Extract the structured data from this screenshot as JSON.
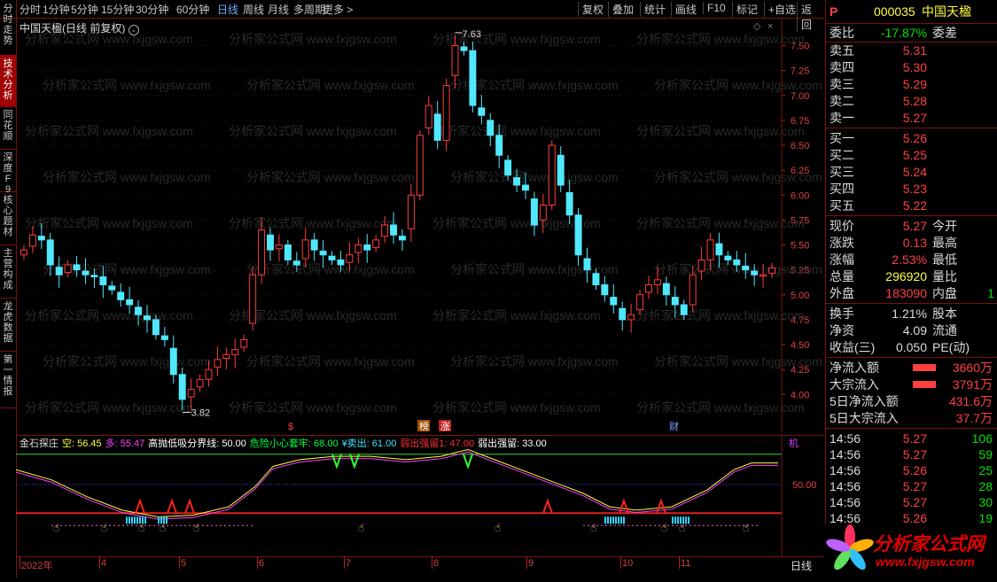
{
  "toolbar": {
    "periods": [
      "分时",
      "1分钟",
      "5分钟",
      "15分钟",
      "30分钟",
      "60分钟",
      "日线",
      "周线",
      "月线",
      "多周期",
      "更多 >"
    ],
    "active": "日线",
    "actions": [
      "复权",
      "叠加",
      "统计",
      "画线",
      "F10",
      "标记",
      "+自选",
      "返回"
    ]
  },
  "left_tabs": [
    "分时走势",
    "技术分析",
    "同花顺",
    "深度F9",
    "核心题材",
    "主营构成",
    "龙虎数据",
    "第一情报"
  ],
  "chart": {
    "title": "中国天楹(日线 前复权)",
    "high_label": "7.63",
    "low_label": "3.82",
    "y_ticks": [
      "7.50",
      "7.25",
      "7.00",
      "6.75",
      "6.50",
      "6.25",
      "6.00",
      "5.75",
      "5.50",
      "5.25",
      "5.00",
      "4.75",
      "4.50",
      "4.25",
      "4.00"
    ],
    "markers": [
      "$",
      "榜",
      "涨",
      "财"
    ],
    "watermark": "分析家公式网 www.fxjgsw.com"
  },
  "indicator": {
    "name": "金石探庄",
    "items": [
      {
        "text": "空: 56.45",
        "color": "#ffff40"
      },
      {
        "text": "多: 55.47",
        "color": "#ff40ff"
      },
      {
        "text": "高抛低吸分界线: 50.00",
        "color": "#ffffff"
      },
      {
        "text": "危险小心套牢: 68.00",
        "color": "#00ff40"
      },
      {
        "text": "¥卖出: 61.00",
        "color": "#40e0ff"
      },
      {
        "text": "弱出强留1: 47.00",
        "color": "#ff3030"
      },
      {
        "text": "弱出强留: 33.00",
        "color": "#ffffff"
      }
    ],
    "corner_label": "机",
    "y_tick": "50.00"
  },
  "time_axis": {
    "labels": [
      "2022年",
      "4",
      "5",
      "6",
      "7",
      "8",
      "9",
      "10",
      "11"
    ],
    "period": "日线"
  },
  "quote": {
    "code": "000035",
    "name": "中国天楹",
    "badge": "P",
    "weibi_label": "委比",
    "weibi": "-17.87%",
    "weicha_label": "委差",
    "sells": [
      {
        "label": "卖五",
        "price": "5.31"
      },
      {
        "label": "卖四",
        "price": "5.30"
      },
      {
        "label": "卖三",
        "price": "5.29"
      },
      {
        "label": "卖二",
        "price": "5.28"
      },
      {
        "label": "卖一",
        "price": "5.27"
      }
    ],
    "buys": [
      {
        "label": "买一",
        "price": "5.26"
      },
      {
        "label": "买二",
        "price": "5.25"
      },
      {
        "label": "买三",
        "price": "5.24"
      },
      {
        "label": "买四",
        "price": "5.23"
      },
      {
        "label": "买五",
        "price": "5.22"
      }
    ],
    "stats": [
      {
        "label": "现价",
        "value": "5.27",
        "color": "#ff4040",
        "label2": "今开"
      },
      {
        "label": "涨跌",
        "value": "0.13",
        "color": "#ff4040",
        "label2": "最高"
      },
      {
        "label": "涨幅",
        "value": "2.53%",
        "color": "#ff4040",
        "label2": "最低"
      },
      {
        "label": "总量",
        "value": "296920",
        "color": "#ffff40",
        "label2": "量比"
      },
      {
        "label": "外盘",
        "value": "183090",
        "color": "#ff4040",
        "label2": "内盘",
        "extra": "1"
      }
    ],
    "stats2": [
      {
        "label": "换手",
        "value": "1.21%",
        "label2": "股本"
      },
      {
        "label": "净资",
        "value": "4.09",
        "label2": "流通"
      },
      {
        "label": "收益(三)",
        "value": "0.050",
        "label2": "PE(动)"
      }
    ],
    "flows": [
      {
        "label": "净流入额",
        "value": "3660万",
        "bar": true
      },
      {
        "label": "大宗流入",
        "value": "3791万",
        "bar": true
      },
      {
        "label": "5日净流入额",
        "value": "431.6万",
        "bar": false
      },
      {
        "label": "5日大宗流入",
        "value": "37.7万",
        "bar": false
      }
    ],
    "ticks": [
      {
        "time": "14:56",
        "price": "5.27",
        "vol": "106"
      },
      {
        "time": "14:56",
        "price": "5.27",
        "vol": "59"
      },
      {
        "time": "14:56",
        "price": "5.26",
        "vol": "25"
      },
      {
        "time": "14:56",
        "price": "5.27",
        "vol": "28"
      },
      {
        "time": "14:56",
        "price": "5.27",
        "vol": "30"
      },
      {
        "time": "14:56",
        "price": "5.26",
        "vol": "19"
      }
    ]
  },
  "logo": {
    "text": "分析家公式网",
    "url": "www.fxjgsw.com"
  },
  "chart_data": {
    "type": "candlestick",
    "ylim": [
      3.7,
      7.7
    ],
    "close_approx": [
      5.45,
      5.6,
      5.55,
      5.3,
      5.2,
      5.3,
      5.25,
      5.2,
      5.18,
      5.1,
      5.05,
      4.95,
      4.9,
      4.8,
      4.75,
      4.6,
      4.55,
      4.2,
      3.95,
      4.05,
      4.15,
      4.25,
      4.35,
      4.4,
      4.45,
      4.55,
      5.2,
      5.65,
      5.45,
      5.5,
      5.35,
      5.3,
      5.55,
      5.45,
      5.4,
      5.35,
      5.3,
      5.4,
      5.5,
      5.45,
      5.55,
      5.7,
      5.6,
      5.55,
      6.0,
      6.6,
      6.9,
      6.55,
      7.1,
      7.5,
      7.45,
      6.9,
      6.8,
      6.6,
      6.4,
      6.2,
      6.1,
      6.05,
      5.7,
      5.9,
      6.5,
      6.1,
      5.8,
      5.4,
      5.25,
      5.1,
      5.0,
      4.9,
      4.75,
      4.8,
      5.0,
      5.1,
      5.15,
      5.0,
      4.9,
      4.8,
      5.2,
      5.35,
      5.55,
      5.4,
      5.35,
      5.3,
      5.25,
      5.2,
      5.2,
      5.27
    ]
  }
}
